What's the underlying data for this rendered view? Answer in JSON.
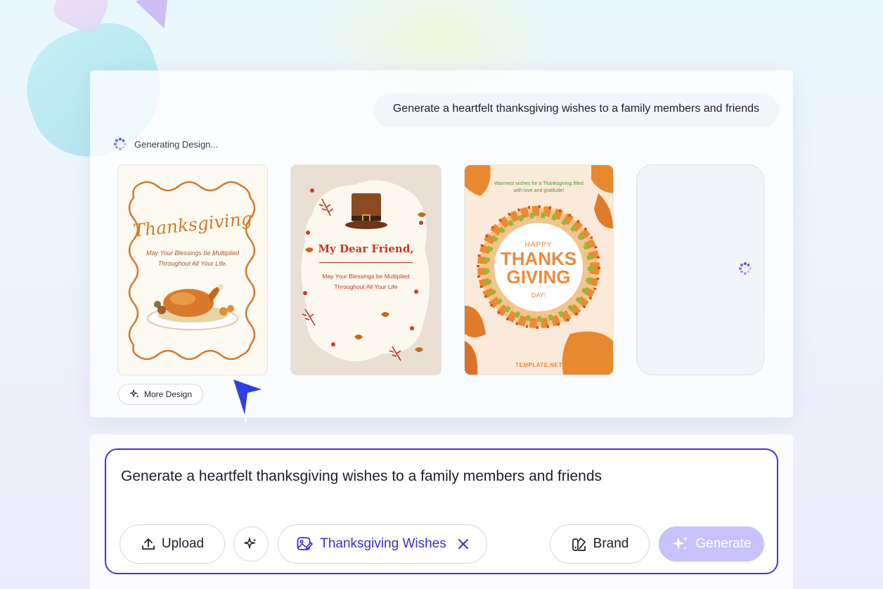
{
  "conversation": {
    "prompt_bubble": "Generate a heartfelt thanksgiving wishes to a family members and friends",
    "status": "Generating Design..."
  },
  "cards": [
    {
      "title": "Thanksgiving",
      "message_line1": "May Your Blessings be Multiplied",
      "message_line2": "Throughout All Your Life."
    },
    {
      "title": "My Dear Friend,",
      "message_line1": "May Your Blessings be Multiplied",
      "message_line2": "Throughout All Your Life"
    },
    {
      "top_line1": "Warmest wishes for a Thanksgiving filled",
      "top_line2": "with love and gratitude!",
      "happy": "HAPPY",
      "big1": "THANKS",
      "big2": "GIVING",
      "day": "DAY!",
      "brand": "TEMPLATE.NET"
    }
  ],
  "more_design_label": "More Design",
  "composer": {
    "text": "Generate a heartfelt thanksgiving wishes to a family members and friends",
    "upload_label": "Upload",
    "tag_label": "Thanksgiving Wishes",
    "brand_label": "Brand",
    "generate_label": "Generate"
  },
  "icons": {
    "spinner": "loading-spinner-icon",
    "sparkles": "sparkles-icon",
    "upload": "upload-icon",
    "tag_image": "image-edit-icon",
    "close": "close-icon",
    "brand": "palette-icon",
    "cursor": "pointer-cursor-icon"
  },
  "colors": {
    "accent": "#4236d4",
    "generate_disabled": "#c7c2fb",
    "card_orange": "#d17b2b",
    "card_red": "#c23a1f"
  }
}
